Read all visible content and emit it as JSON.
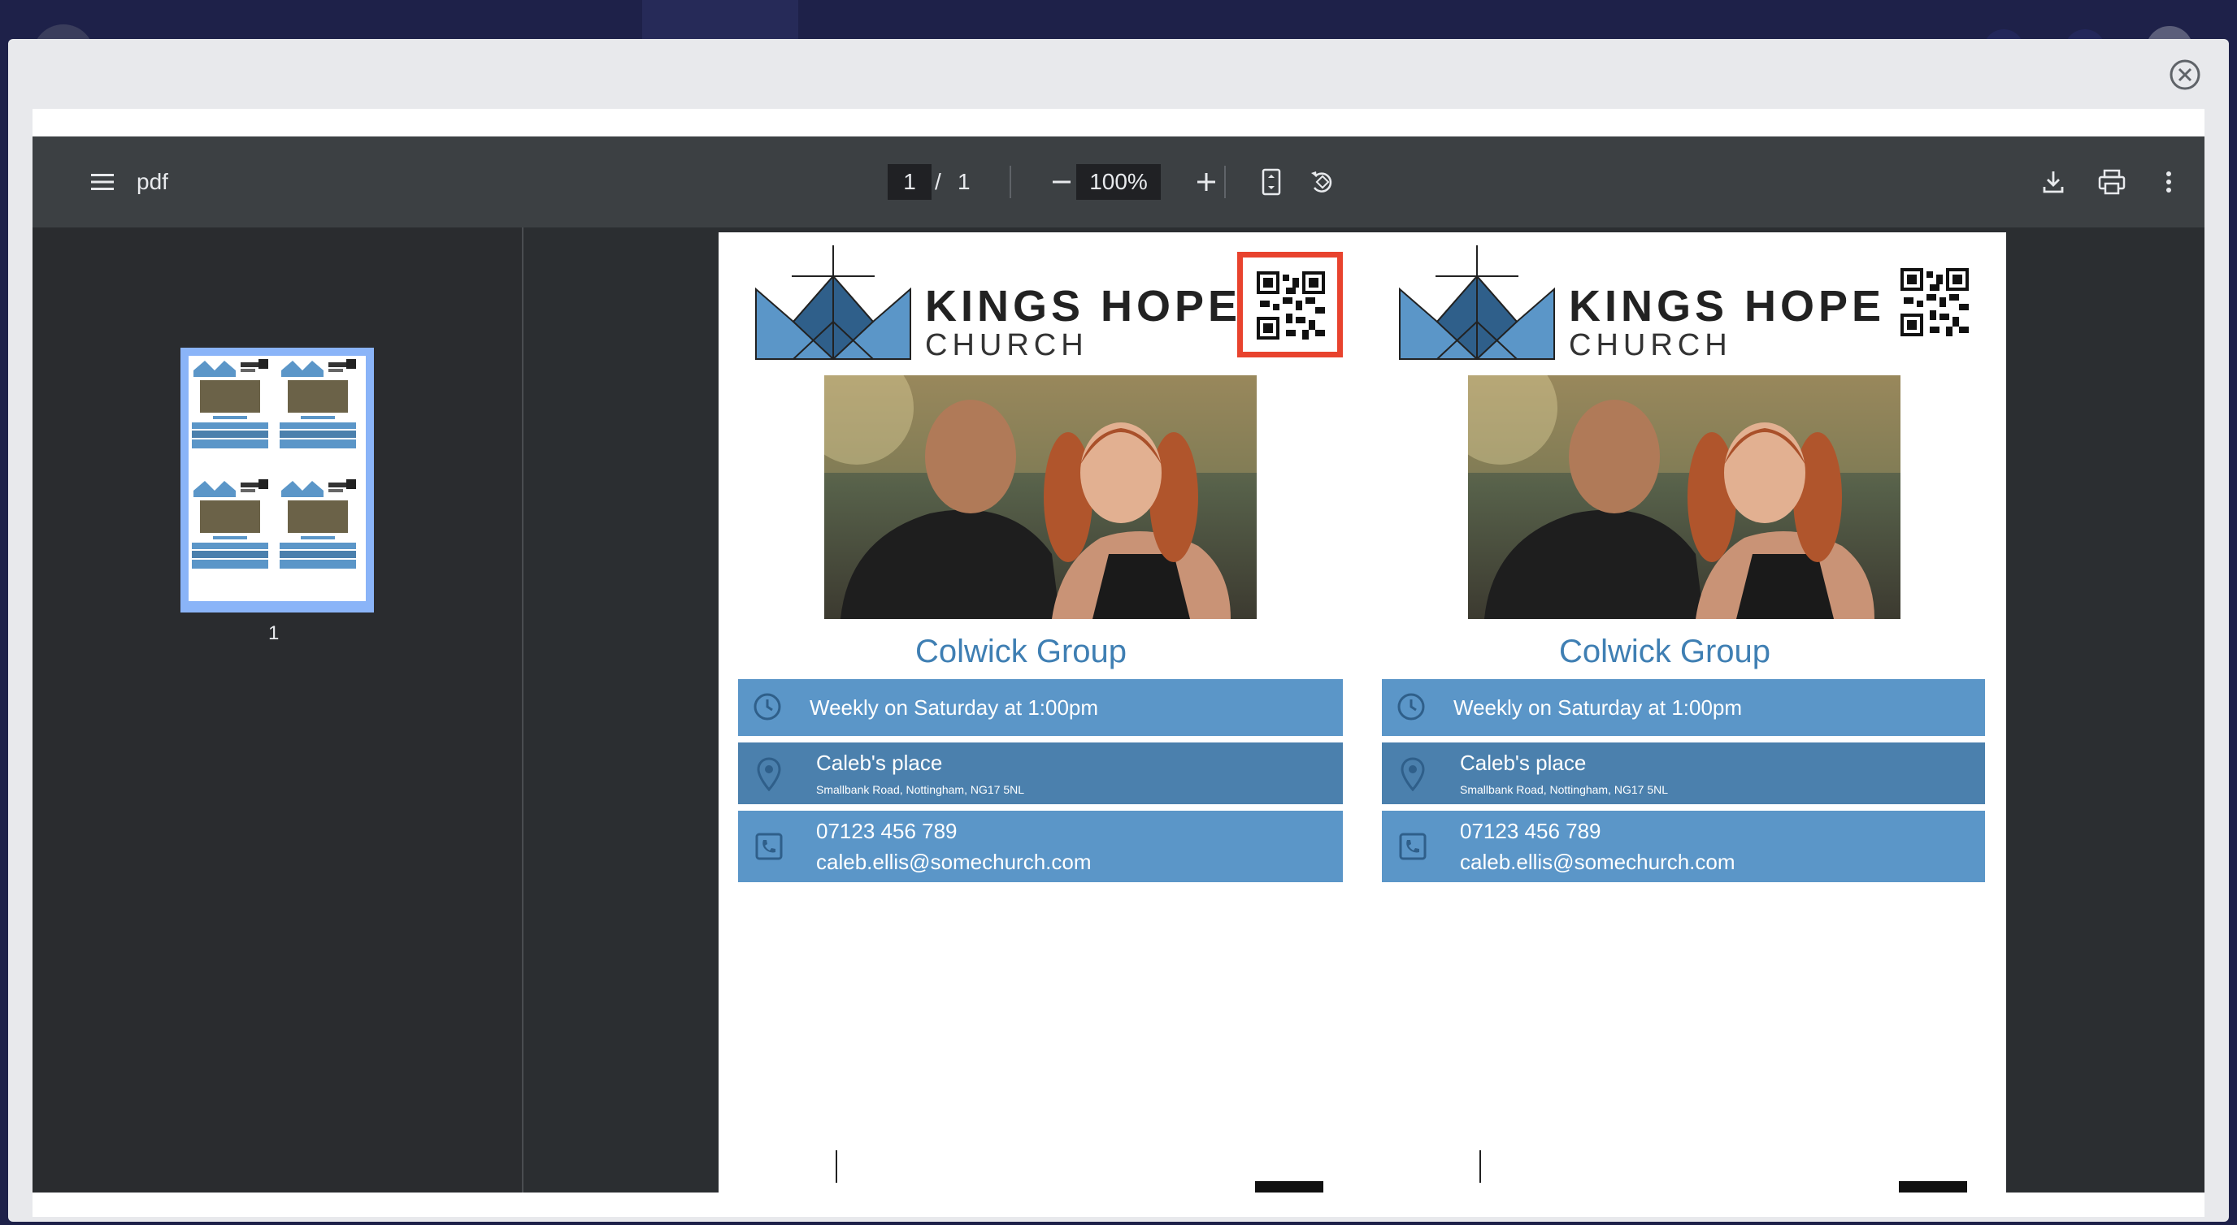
{
  "viewer": {
    "title": "pdf",
    "current_page": "1",
    "page_separator": "/",
    "total_pages": "1",
    "zoom": "100%",
    "thumbnail_label": "1"
  },
  "card": {
    "brand_line1": "KINGS HOPE",
    "brand_line2": "CHURCH",
    "group_name": "Colwick Group",
    "schedule": "Weekly on Saturday at 1:00pm",
    "location_name": "Caleb's place",
    "location_address": "Smallbank Road, Nottingham, NG17 5NL",
    "phone": "07123 456 789",
    "email": "caleb.ellis@somechurch.com"
  },
  "colors": {
    "accent_blue": "#5b96c8",
    "title_blue": "#3f7fb3",
    "highlight_red": "#e8432e"
  }
}
